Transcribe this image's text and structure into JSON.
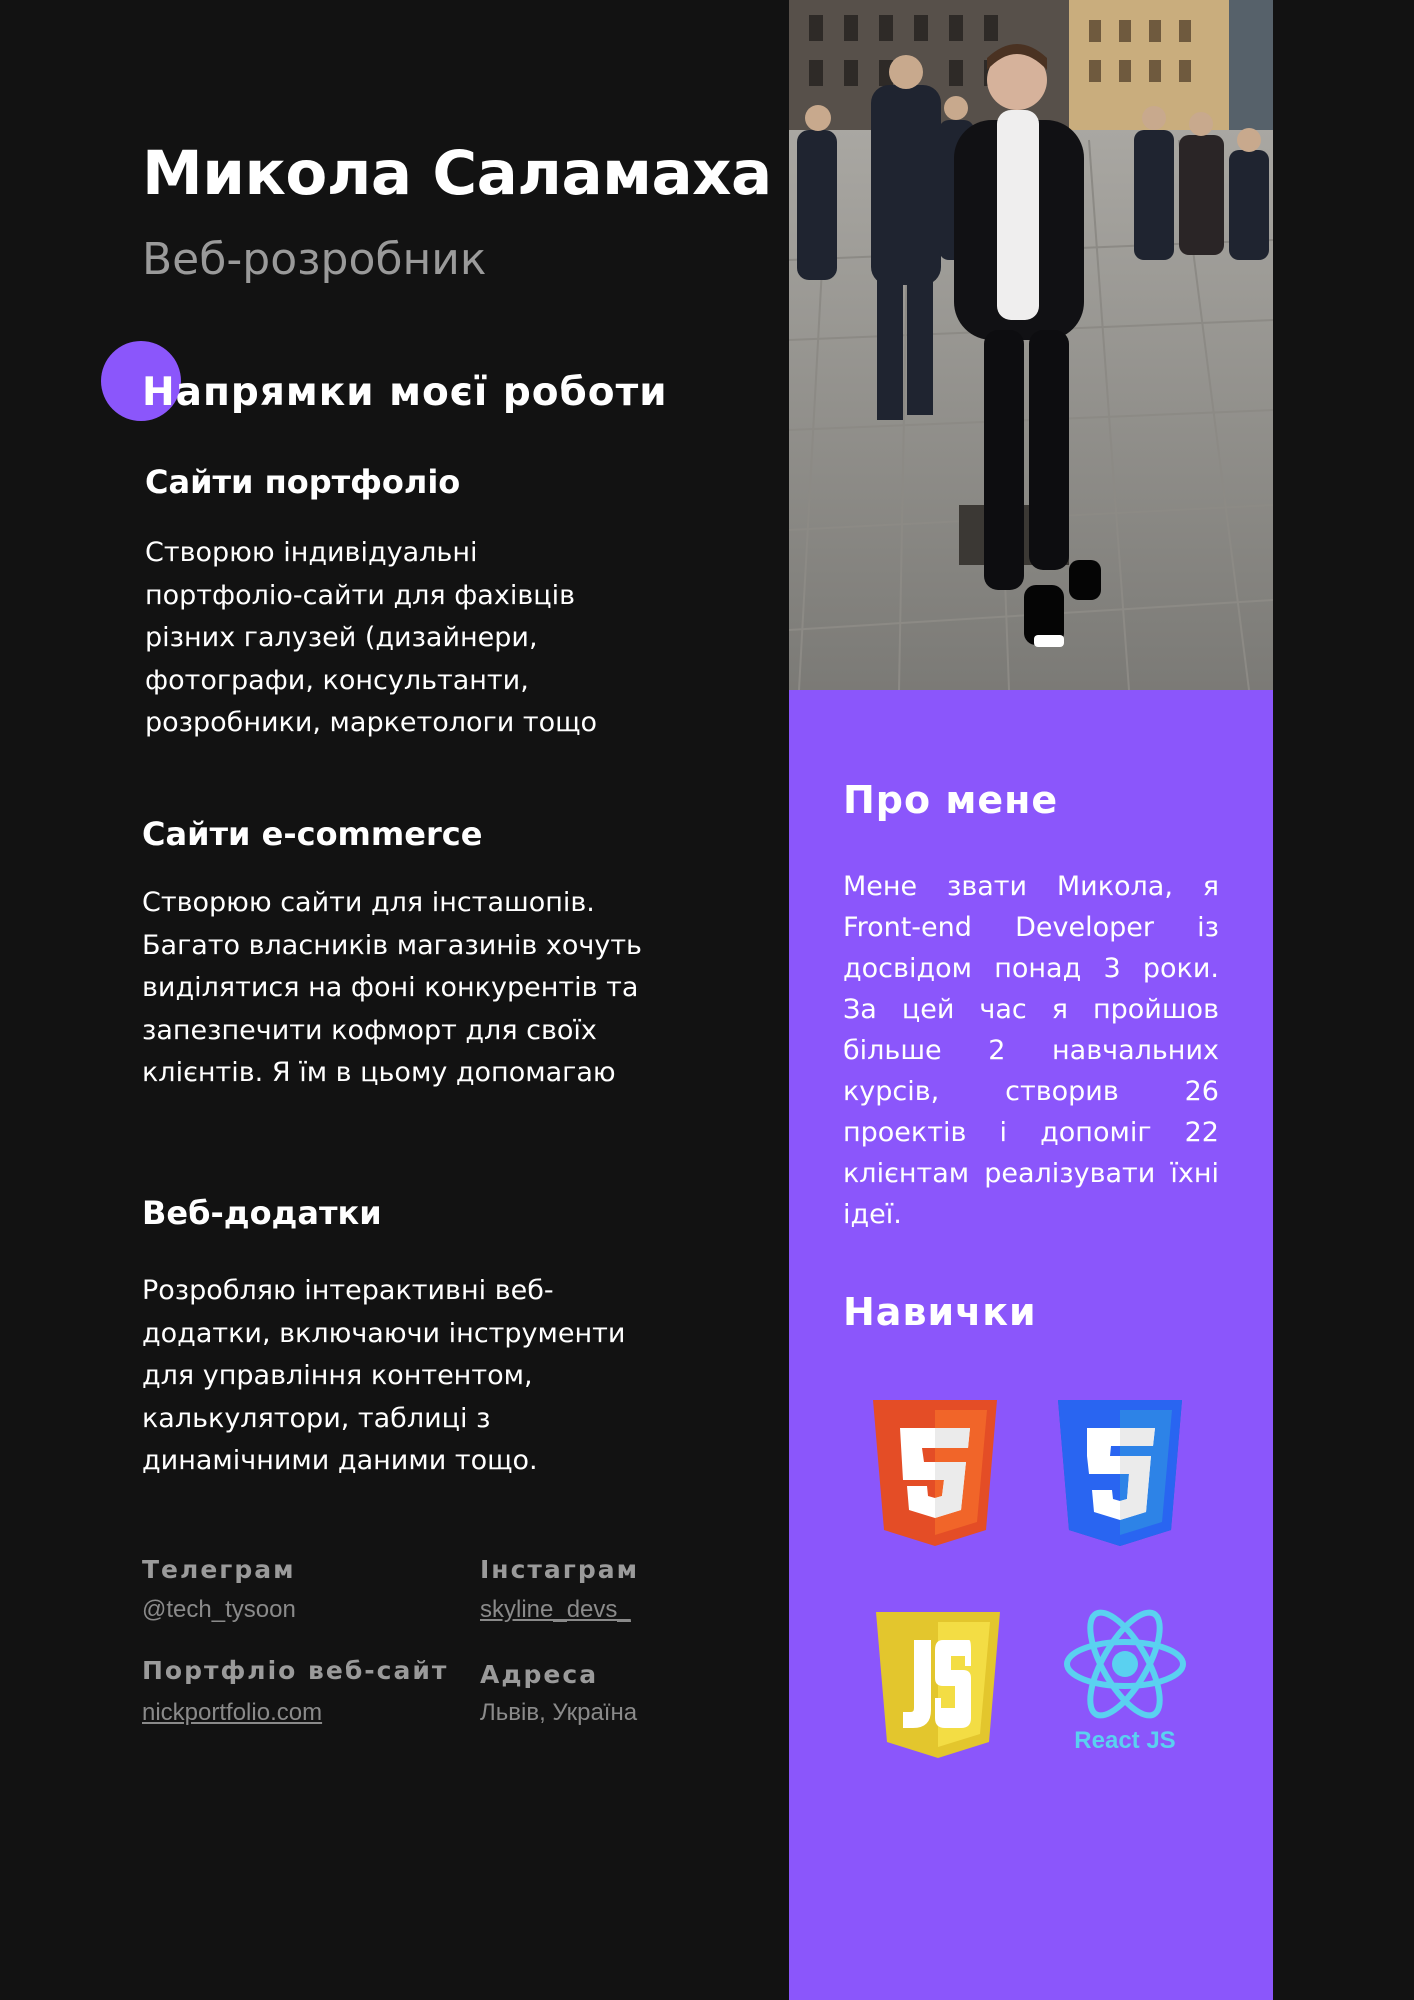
{
  "header": {
    "name": "Микола Саламаха",
    "role": "Веб-розробник"
  },
  "services": {
    "section_title": "Напрямки моєї роботи",
    "items": [
      {
        "title": "Сайти портфоліо",
        "lines": [
          "Створюю індивідуальні",
          "портфоліо-сайти для фахівців",
          "різних галузей (дизайнери,",
          "фотографи, консультанти,",
          "розробники, маркетологи тощо"
        ]
      },
      {
        "title": "Сайти e-commerce",
        "lines": [
          "Створюю сайти для інсташопів.",
          "Багато власників магазинів хочуть",
          "виділятися на фоні конкурентів та",
          "запезпечити кофморт для своїх",
          "клієнтів. Я їм в цьому допомагаю"
        ]
      },
      {
        "title": "Веб-додатки",
        "lines": [
          "Розробляю інтерактивні веб-",
          "додатки, включаючи інструменти",
          "для управління контентом,",
          "калькулятори, таблиці з",
          "динамічними даними тощо."
        ]
      }
    ]
  },
  "contacts": {
    "telegram_label": "Телеграм",
    "telegram_value": "@tech_tysoon",
    "instagram_label": "Інстаграм",
    "instagram_value": "skyline_devs_",
    "portfolio_label": "Портфліо веб-сайт",
    "portfolio_value": "nickportfolio.com",
    "address_label": "Адреса",
    "address_value": "Львів, Україна"
  },
  "about": {
    "title": "Про мене",
    "text": "Мене звати Микола, я Front-end Developer із досвідом понад 3 роки. За цей час я пройшов більше 2 навчальних курсів, створив 26 проектів і допоміг 22 клієнтам реалізувати їхні ідеї."
  },
  "skills": {
    "title": "Навички",
    "items": [
      {
        "name": "HTML5",
        "icon": "html5-icon",
        "color": "#e44d26"
      },
      {
        "name": "CSS3",
        "icon": "css3-icon",
        "color": "#2965f1"
      },
      {
        "name": "JavaScript",
        "icon": "javascript-icon",
        "color": "#f0db4f"
      },
      {
        "name": "React JS",
        "icon": "react-icon",
        "color": "#5ad1f0",
        "label": "React JS"
      }
    ]
  },
  "colors": {
    "background": "#121212",
    "accent": "#8b56fb",
    "muted": "#9a9a9a"
  }
}
